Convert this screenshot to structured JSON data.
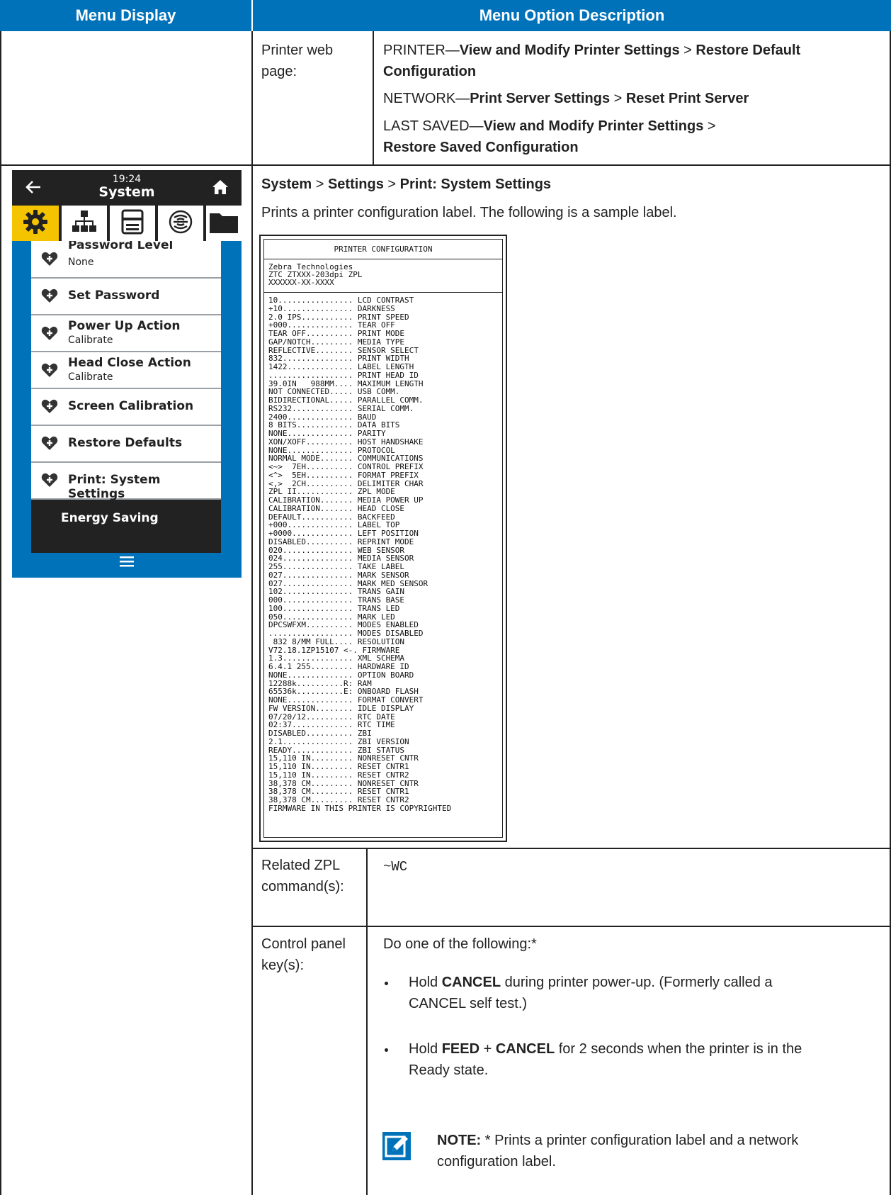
{
  "header": {
    "col1": "Menu Display",
    "col2": "Menu Option Description"
  },
  "top_rows": {
    "label": "Printer web page:",
    "printer_prefix": "PRINTER—",
    "printer_b1": "View and Modify Printer Settings",
    "printer_sep": " > ",
    "printer_b2": "Restore Default Configuration",
    "network_prefix": "NETWORK—",
    "network_b1": "Print Server Settings",
    "network_sep": " > ",
    "network_b2": "Reset Print Server",
    "last_prefix": "LAST SAVED—",
    "last_b1": "View and Modify Printer Settings",
    "last_sep": " >",
    "last_b2": "Restore Saved Configuration"
  },
  "phone": {
    "time": "19:24",
    "title": "System",
    "icons": [
      "back-arrow-icon",
      "home-icon",
      "gear-icon",
      "network-icon",
      "printer-icon",
      "wireless-icon",
      "folder-icon",
      "hamburger-menu-icon",
      "heart-plus-icon"
    ],
    "items": [
      {
        "label": "Password Level",
        "sub": "None"
      },
      {
        "label": "Set Password",
        "sub": ""
      },
      {
        "label": "Power Up Action",
        "sub": "Calibrate"
      },
      {
        "label": "Head Close Action",
        "sub": "Calibrate"
      },
      {
        "label": "Screen Calibration",
        "sub": ""
      },
      {
        "label": "Restore Defaults",
        "sub": ""
      },
      {
        "label": "Print: System Settings",
        "sub": ""
      }
    ],
    "energy": "Energy Saving",
    "colors": {
      "blue": "#0072ba",
      "dark": "#222222",
      "accent": "#f5c400"
    }
  },
  "system": {
    "path_b1": "System",
    "path_sep1": " > ",
    "path_b2": "Settings",
    "path_sep2": " > ",
    "path_b3": "Print: System Settings",
    "description": "Prints a printer configuration label. The following is a sample label.",
    "label": {
      "title": "PRINTER CONFIGURATION",
      "header_lines": [
        "Zebra Technologies",
        "ZTC ZTXXX-203dpi ZPL",
        "XXXXXX-XX-XXXX"
      ],
      "lines": [
        "10................ LCD CONTRAST",
        "+10............... DARKNESS",
        "2.0 IPS........... PRINT SPEED",
        "+000.............. TEAR OFF",
        "TEAR OFF.......... PRINT MODE",
        "GAP/NOTCH......... MEDIA TYPE",
        "REFLECTIVE........ SENSOR SELECT",
        "832............... PRINT WIDTH",
        "1422.............. LABEL LENGTH",
        ".................. PRINT HEAD ID",
        "39.0IN   988MM.... MAXIMUM LENGTH",
        "NOT CONNECTED..... USB COMM.",
        "BIDIRECTIONAL..... PARALLEL COMM.",
        "RS232............. SERIAL COMM.",
        "2400.............. BAUD",
        "8 BITS............ DATA BITS",
        "NONE.............. PARITY",
        "XON/XOFF.......... HOST HANDSHAKE",
        "NONE.............. PROTOCOL",
        "NORMAL MODE....... COMMUNICATIONS",
        "<~>  7EH.......... CONTROL PREFIX",
        "<^>  5EH.......... FORMAT PREFIX",
        "<,>  2CH.......... DELIMITER CHAR",
        "ZPL II............ ZPL MODE",
        "CALIBRATION....... MEDIA POWER UP",
        "CALIBRATION....... HEAD CLOSE",
        "DEFAULT........... BACKFEED",
        "+000.............. LABEL TOP",
        "+0000............. LEFT POSITION",
        "DISABLED.......... REPRINT MODE",
        "020............... WEB SENSOR",
        "024............... MEDIA SENSOR",
        "255............... TAKE LABEL",
        "027............... MARK SENSOR",
        "027............... MARK MED SENSOR",
        "102............... TRANS GAIN",
        "000............... TRANS BASE",
        "100............... TRANS LED",
        "050............... MARK LED",
        "DPCSWFXM.......... MODES ENABLED",
        ".................. MODES DISABLED",
        " 832 8/MM FULL.... RESOLUTION",
        "V72.18.1ZP15107 <-. FIRMWARE",
        "1.3............... XML SCHEMA",
        "6.4.1 255......... HARDWARE ID",
        "NONE.............. OPTION BOARD",
        "12288k..........R: RAM",
        "65536k..........E: ONBOARD FLASH",
        "NONE.............. FORMAT CONVERT",
        "FW VERSION........ IDLE DISPLAY",
        "07/20/12.......... RTC DATE",
        "02:37............. RTC TIME",
        "DISABLED.......... ZBI",
        "2.1............... ZBI VERSION",
        "READY............. ZBI STATUS",
        "15,110 IN......... NONRESET CNTR",
        "15,110 IN......... RESET CNTR1",
        "15,110 IN......... RESET CNTR2",
        "38,378 CM......... NONRESET CNTR",
        "38,378 CM......... RESET CNTR1",
        "38,378 CM......... RESET CNTR2",
        "FIRMWARE IN THIS PRINTER IS COPYRIGHTED"
      ]
    }
  },
  "zpl": {
    "label": "Related ZPL command(s):",
    "value": "~WC"
  },
  "control": {
    "label": "Control panel key(s):",
    "intro": "Do one of the following:*",
    "b1_pre": "Hold ",
    "b1_key": "CANCEL",
    "b1_post": " during printer power-up. (Formerly called a CANCEL self test.)",
    "b2_pre": "Hold ",
    "b2_key1": "FEED",
    "b2_mid": " + ",
    "b2_key2": "CANCEL",
    "b2_post": " for 2 seconds when the printer is in the Ready state.",
    "note_label": "NOTE:",
    "note_text": " * Prints a printer configuration label and a network configuration label.",
    "note_icon": "note-pencil-icon"
  }
}
